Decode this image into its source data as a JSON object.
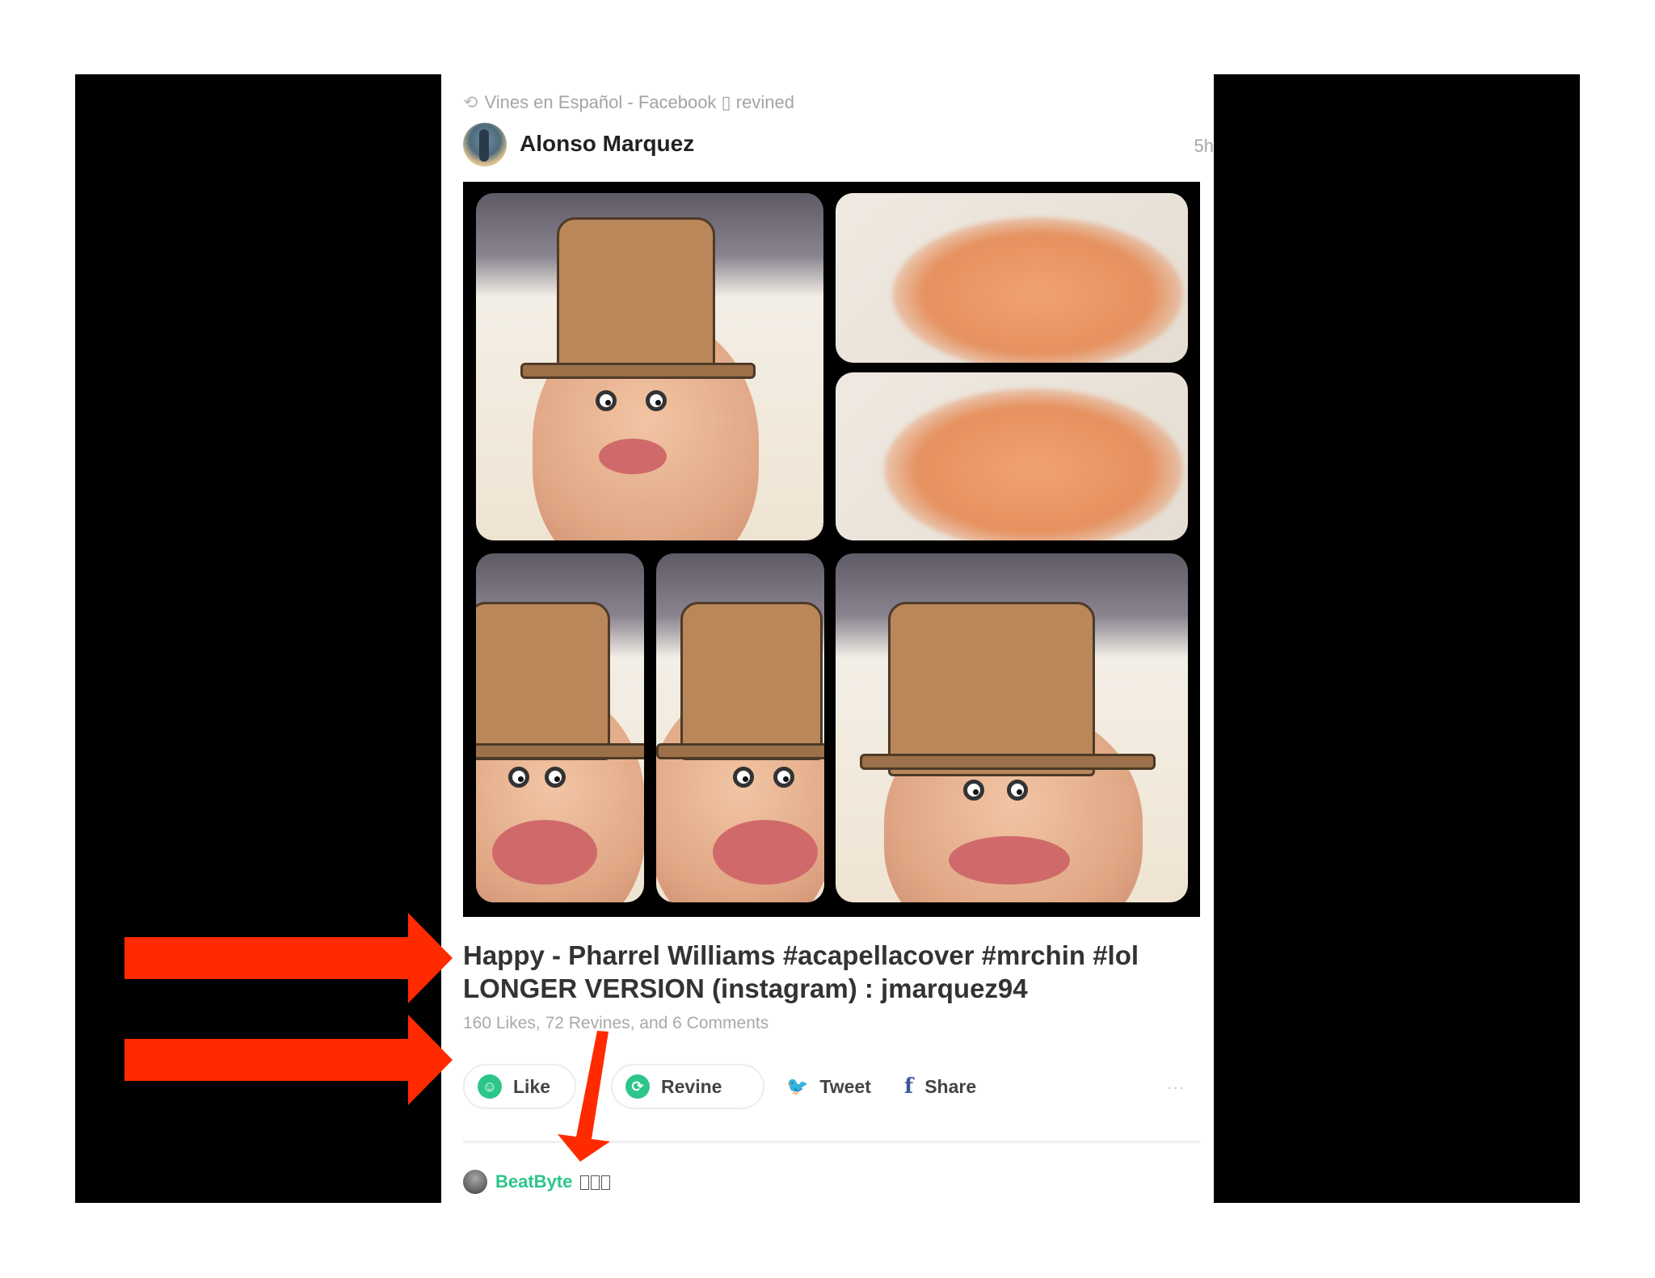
{
  "post": {
    "revine_note": "Vines en Español - Facebook ▯ revined",
    "author": "Alonso Marquez",
    "timestamp": "5h",
    "caption_line1": "Happy - Pharrel Williams #acapellacover #mrchin #lol",
    "caption_line2": "LONGER VERSION (instagram) : jmarquez94",
    "stats": "160 Likes, 72 Revines, and 6 Comments"
  },
  "actions": {
    "like": "Like",
    "revine": "Revine",
    "tweet": "Tweet",
    "share": "Share",
    "more": "..."
  },
  "comment": {
    "user": "BeatByte"
  },
  "colors": {
    "accent": "#2cc68a",
    "annotation_arrows": "#ff2a00",
    "twitter": "#2e9be6",
    "facebook": "#3b5998"
  },
  "icons": {
    "revine_note": "revine-icon",
    "like": "smile-icon",
    "revine": "revine-icon",
    "tweet": "twitter-bird-icon",
    "share": "facebook-icon",
    "more": "ellipsis-icon"
  }
}
